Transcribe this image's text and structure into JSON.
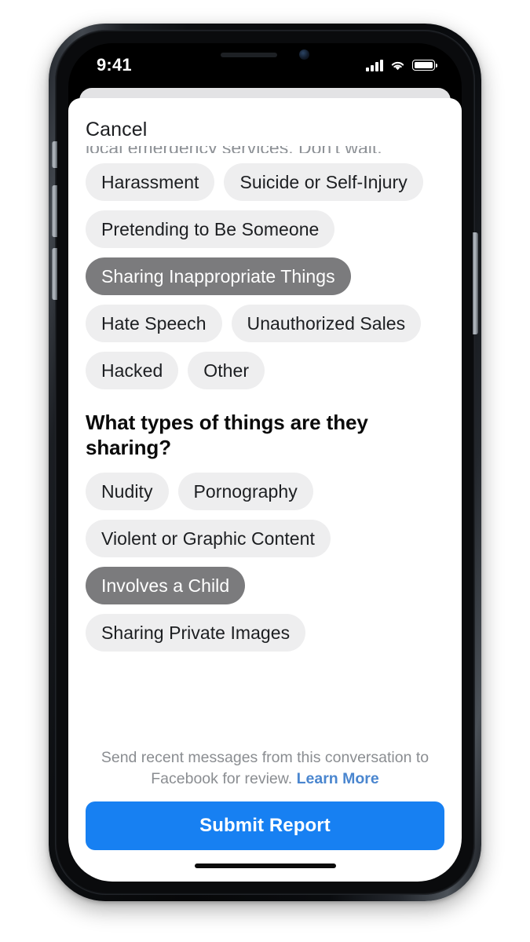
{
  "status_bar": {
    "time": "9:41",
    "signal_icon": "cellular-signal-icon",
    "wifi_icon": "wifi-icon",
    "battery_icon": "battery-full-icon"
  },
  "sheet": {
    "cancel_label": "Cancel",
    "clipped_text": "local emergency services. Don't wait.",
    "reason_chips": [
      {
        "label": "Harassment",
        "selected": false
      },
      {
        "label": "Suicide or Self-Injury",
        "selected": false
      },
      {
        "label": "Pretending to Be Someone",
        "selected": false
      },
      {
        "label": "Sharing Inappropriate Things",
        "selected": true
      },
      {
        "label": "Hate Speech",
        "selected": false
      },
      {
        "label": "Unauthorized Sales",
        "selected": false
      },
      {
        "label": "Hacked",
        "selected": false
      },
      {
        "label": "Other",
        "selected": false
      }
    ],
    "section_heading": "What types of things are they sharing?",
    "type_chips": [
      {
        "label": "Nudity",
        "selected": false
      },
      {
        "label": "Pornography",
        "selected": false
      },
      {
        "label": "Violent or Graphic Content",
        "selected": false
      },
      {
        "label": "Involves a Child",
        "selected": true
      },
      {
        "label": "Sharing Private Images",
        "selected": false
      }
    ],
    "footer_note": "Send recent messages from this conversation to Facebook for review.",
    "learn_more_label": "Learn More",
    "submit_label": "Submit Report"
  },
  "device": {
    "speaker_icon": "speaker-grille-icon",
    "camera_icon": "front-camera-icon",
    "home_indicator": "home-indicator",
    "buttons": {
      "mute": "mute-switch",
      "volume_up": "volume-up-button",
      "volume_down": "volume-down-button",
      "power": "power-button"
    }
  },
  "colors": {
    "accent_blue": "#1780f2",
    "link_blue": "#4a86cf",
    "chip_bg": "#eeeeef",
    "chip_selected_bg": "#7b7b7d"
  }
}
